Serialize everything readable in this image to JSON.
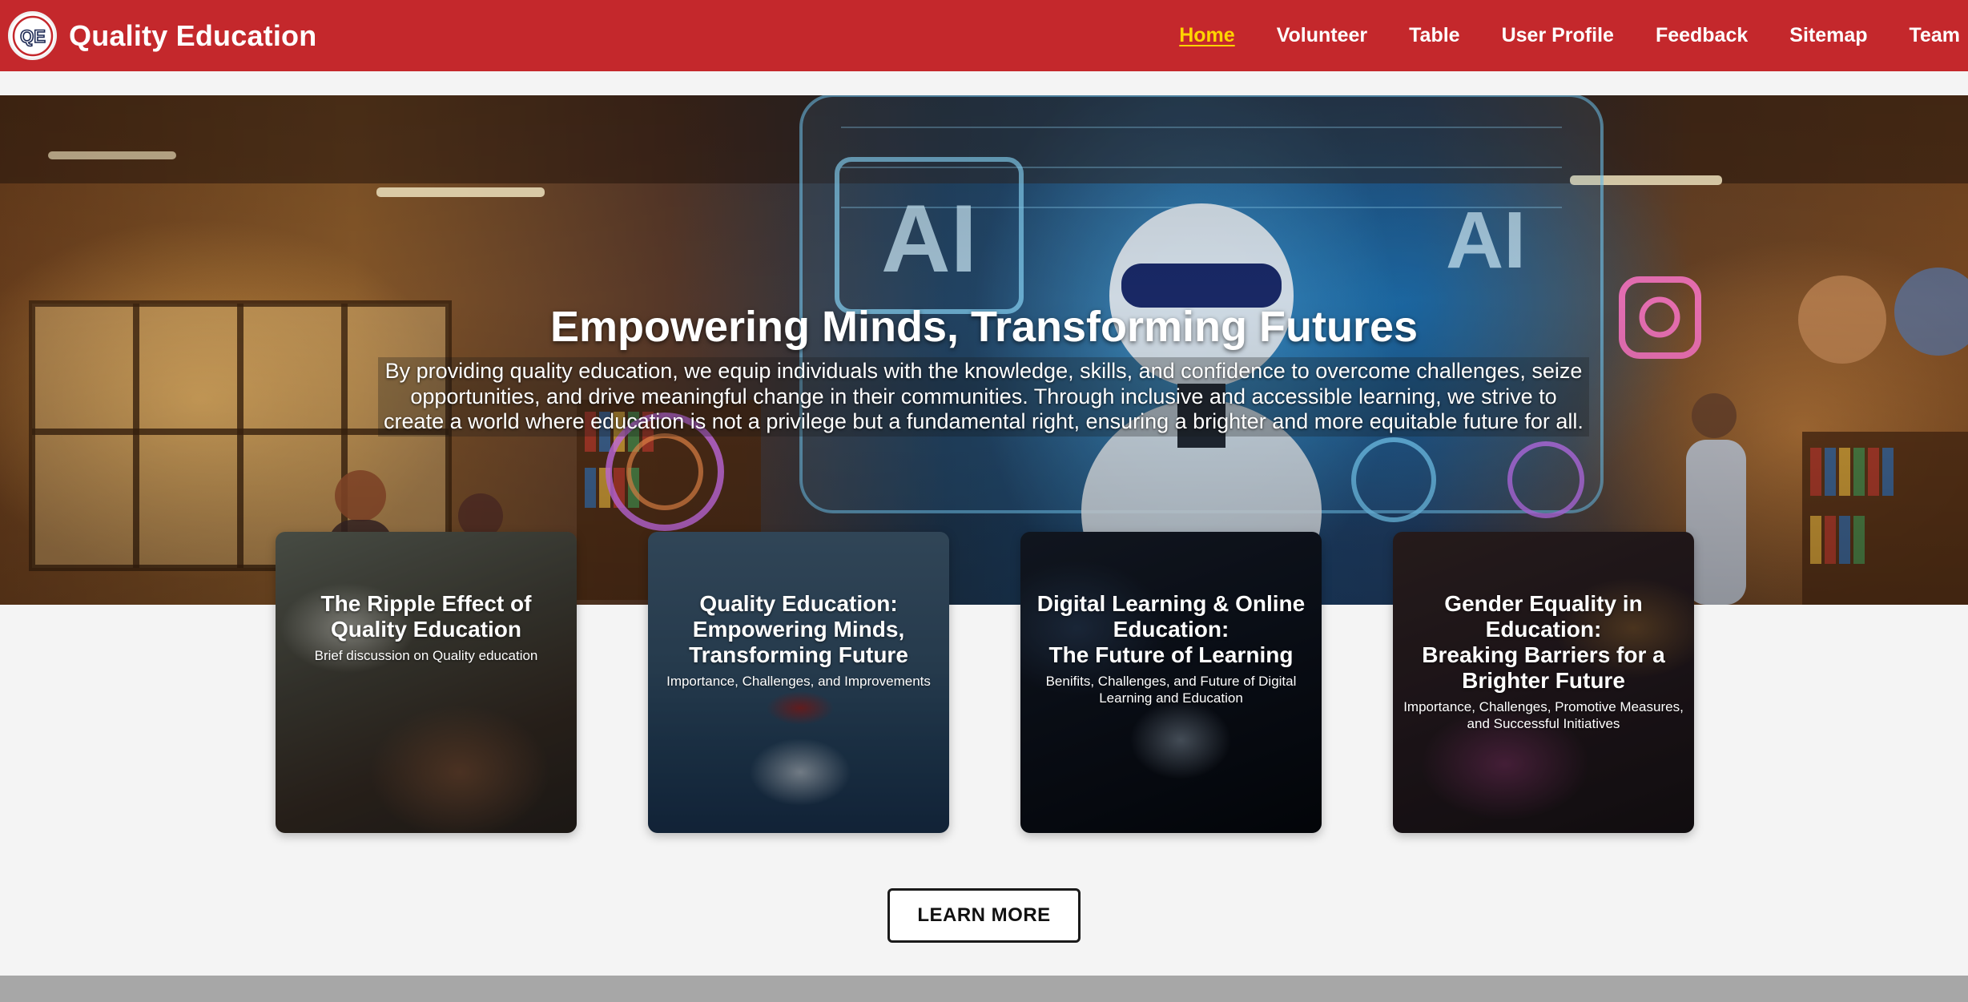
{
  "header": {
    "brand": {
      "logo_text": "QE",
      "title": "Quality Education"
    },
    "nav": [
      {
        "label": "Home",
        "active": true
      },
      {
        "label": "Volunteer"
      },
      {
        "label": "Table"
      },
      {
        "label": "User Profile"
      },
      {
        "label": "Feedback"
      },
      {
        "label": "Sitemap"
      },
      {
        "label": "Team"
      }
    ]
  },
  "hero": {
    "title": "Empowering Minds, Transforming Futures",
    "text": "By providing quality education, we equip individuals with the knowledge, skills, and confidence to overcome challenges, seize opportunities, and drive meaningful change in their communities. Through inclusive and accessible learning, we strive to create a world where education is not a privilege but a fundamental right, ensuring a brighter and more equitable future for all."
  },
  "cards": [
    {
      "title": "The Ripple Effect of Quality Education",
      "subtitle": "Brief discussion on Quality education"
    },
    {
      "title": "Quality Education: Empowering Minds, Transforming Future",
      "subtitle": "Importance, Challenges, and Improvements"
    },
    {
      "title": "Digital Learning & Online Education:\nThe Future of Learning",
      "subtitle": "Benifits, Challenges, and Future of Digital Learning and Education"
    },
    {
      "title": "Gender Equality in Education:\nBreaking Barriers for a Brighter Future",
      "subtitle": "Importance, Challenges, Promotive Measures, and Successful Initiatives"
    }
  ],
  "cta": {
    "learn_more": "LEARN MORE"
  },
  "colors": {
    "header_bg": "#c4282c",
    "active_nav": "#ffd400",
    "page_bg": "#f4f4f4",
    "footer_strip": "#a7a7a7"
  }
}
